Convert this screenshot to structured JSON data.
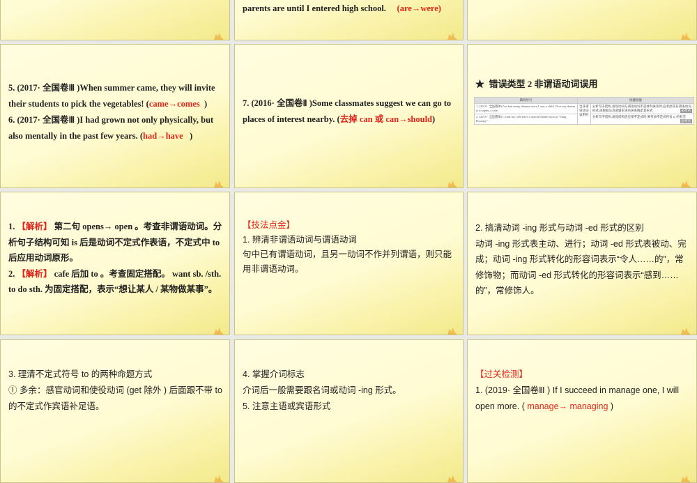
{
  "slides": [
    {
      "id": "top-middle",
      "line": "parents are until I entered high school.",
      "answer": "(are→were)"
    },
    {
      "id": "q5-6",
      "q5": "5. (2017· 全国卷Ⅲ )When summer came,  they will invite their students to pick the vegetables! (",
      "a5": "came→comes",
      "q6": "6. (2017· 全国卷Ⅲ )I had grown not only physically, but also mentally in the past few years.  (",
      "a6": "had→have",
      "close": ")"
    },
    {
      "id": "q7",
      "q7": "7. (2016· 全国卷Ⅱ )Some classmates suggest we can go to places of interest nearby.    (",
      "a7": "去掉 can 或 can→should",
      "close": ")"
    },
    {
      "id": "error-type-2",
      "star": "★",
      "title": "错误类型   2     非谓语动词误用",
      "table": {
        "h1": "典例导引",
        "h2": "快捷思维",
        "r1": "1. (2019 · 全国卷Ⅲ) I've had many dreams since I was a child. Now my dream is to opens a cafe.",
        "r2": "2. (2019 · 全国卷Ⅲ) I want my cafe have a special theme such as \"Tang Dynasty\".",
        "mid": "当非谓语动词误用时",
        "t1": "分析句子结构,发现动词与谓语动词不是并列关系时,应考虑其非谓语动词形式,再根据与其逻辑主语的关系确定其形式",
        "t2": "分析句子结构,发现结构后应接不定式时,要考虑不定式符号 to 的有无",
        "tag": "必考点"
      }
    },
    {
      "id": "analysis",
      "l1a": "1. ",
      "l1tag": "【解析】",
      "l1b": " 第二句 opens→ open 。考查非谓语动词。分析句子结构可知 is 后是动词不定式作表语，不定式中 to 后应用动词原形。",
      "l2a": "2. ",
      "l2tag": "【解析】",
      "l2b": "  cafe 后加 to 。考查固定搭配。 want sb. /sth. to do sth. 为固定搭配，表示“想让某人 / 某物做某事”。"
    },
    {
      "id": "tips",
      "heading": "【技法点金】",
      "t1": "1.  辨清非谓语动词与谓语动词",
      "t2": "句中已有谓语动词，且另一动词不作并列谓语，则只能用非谓语动词。"
    },
    {
      "id": "ing-ed",
      "t1": "2.  搞清动词 -ing 形式与动词 -ed 形式的区别",
      "t2": "动词 -ing 形式表主动、进行；动词 -ed 形式表被动、完成；动词 -ing 形式转化的形容词表示“令人……的”，常修饰物；而动词 -ed 形式转化的形容词表示“感到……的”，常修饰人。"
    },
    {
      "id": "to-infinitive",
      "t1": "3.  理清不定式符号 to 的两种命题方式",
      "t2": "① 多余：感官动词和使役动词 (get 除外 ) 后面跟不带 to 的不定式作宾语补足语。"
    },
    {
      "id": "prep",
      "t1": "4.  掌握介词标志",
      "t2": "介词后一般需要跟名词或动词 -ing 形式。",
      "t3": "5.  注意主语或宾语形式"
    },
    {
      "id": "check",
      "heading": "【过关检测】",
      "q1": "1. (2019· 全国卷Ⅲ ) If I succeed in manage one,  I will open more. ( ",
      "a1": "manage→ managing",
      "close": " )"
    }
  ]
}
